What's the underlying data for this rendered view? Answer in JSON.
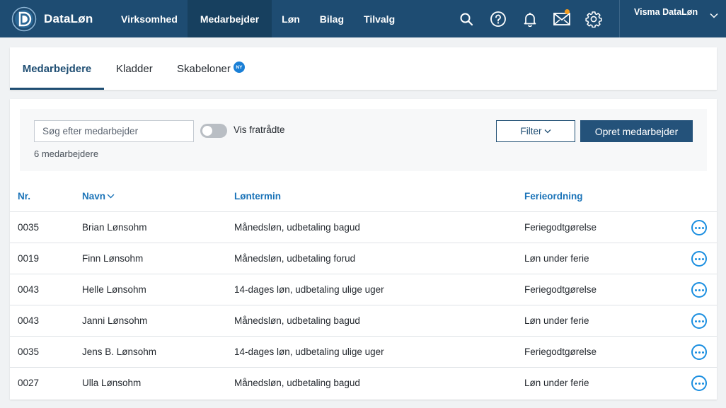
{
  "app": {
    "title": "DataLøn"
  },
  "nav": {
    "items": [
      {
        "label": "Virksomhed",
        "active": false
      },
      {
        "label": "Medarbejder",
        "active": true
      },
      {
        "label": "Løn",
        "active": false
      },
      {
        "label": "Bilag",
        "active": false
      },
      {
        "label": "Tilvalg",
        "active": false
      }
    ]
  },
  "top_icons": [
    "search-icon",
    "help-icon",
    "bell-icon",
    "mail-icon",
    "gear-icon"
  ],
  "account": {
    "name": "Visma DataLøn"
  },
  "tabs": [
    {
      "label": "Medarbejdere",
      "active": true
    },
    {
      "label": "Kladder",
      "active": false
    },
    {
      "label": "Skabeloner",
      "active": false,
      "badge": "NY"
    }
  ],
  "toolbar": {
    "search_placeholder": "Søg efter medarbejder",
    "toggle_label": "Vis fratrådte",
    "toggle_on": false,
    "count": "6 medarbejdere",
    "filter_label": "Filter",
    "create_label": "Opret medarbejder"
  },
  "colors": {
    "topbar": "#1e4c72",
    "accent": "#1a73b8",
    "button": "#24527a",
    "notification": "#f39c1f"
  },
  "table": {
    "headers": {
      "nr": "Nr.",
      "navn": "Navn",
      "lontermin": "Løntermin",
      "ferieordning": "Ferieordning"
    },
    "rows": [
      {
        "nr": "0035",
        "navn": "Brian Lønsohm",
        "lontermin": "Månedsløn, udbetaling bagud",
        "ferieordning": "Feriegodtgørelse"
      },
      {
        "nr": "0019",
        "navn": "Finn Lønsohm",
        "lontermin": "Månedsløn, udbetaling forud",
        "ferieordning": "Løn under ferie"
      },
      {
        "nr": "0043",
        "navn": "Helle Lønsohm",
        "lontermin": "14-dages løn, udbetaling ulige uger",
        "ferieordning": "Feriegodtgørelse"
      },
      {
        "nr": "0043",
        "navn": "Janni Lønsohm",
        "lontermin": "Månedsløn, udbetaling bagud",
        "ferieordning": "Løn under ferie"
      },
      {
        "nr": "0035",
        "navn": "Jens B. Lønsohm",
        "lontermin": "14-dages løn, udbetaling ulige uger",
        "ferieordning": "Feriegodtgørelse"
      },
      {
        "nr": "0027",
        "navn": "Ulla Lønsohm",
        "lontermin": "Månedsløn, udbetaling bagud",
        "ferieordning": "Løn under ferie"
      }
    ]
  }
}
